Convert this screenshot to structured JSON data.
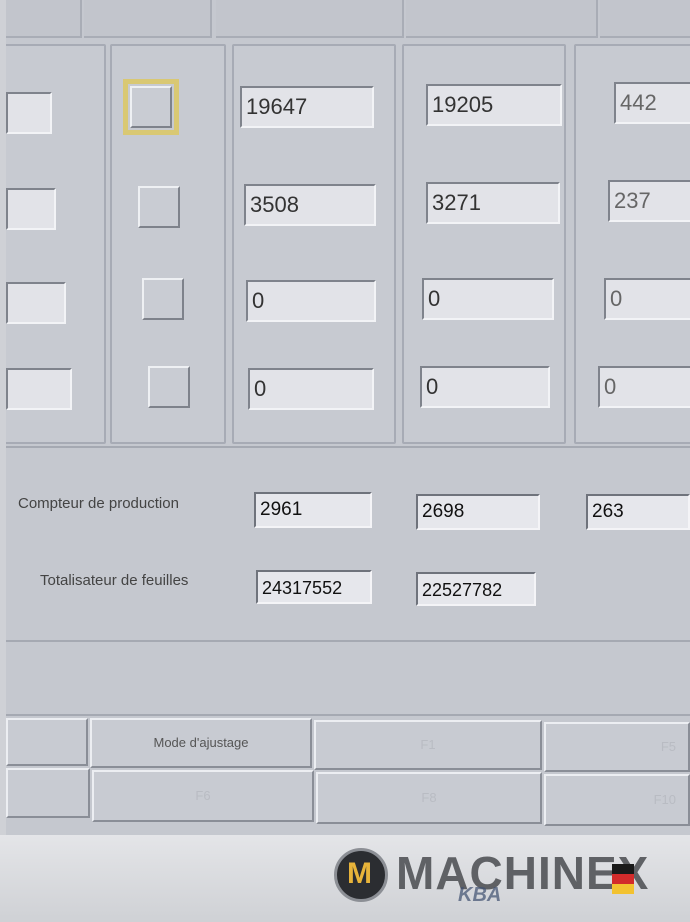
{
  "grid": {
    "rows": [
      {
        "selected": true,
        "col1": "19647",
        "col2": "19205",
        "col3": "442"
      },
      {
        "selected": false,
        "col1": "3508",
        "col2": "3271",
        "col3": "237"
      },
      {
        "selected": false,
        "col1": "0",
        "col2": "0",
        "col3": "0"
      },
      {
        "selected": false,
        "col1": "0",
        "col2": "0",
        "col3": "0"
      }
    ]
  },
  "counters": {
    "production_label": "Compteur de production",
    "production_values": [
      "2961",
      "2698",
      "263"
    ],
    "totalizer_label": "Totalisateur de feuilles",
    "totalizer_values": [
      "24317552",
      "22527782"
    ]
  },
  "buttons": {
    "row1": [
      "",
      "Mode d'ajustage",
      "F1",
      "F5"
    ],
    "row2": [
      "",
      "F6",
      "F8",
      "F10"
    ]
  },
  "watermark": {
    "brand": "MACHINEX",
    "sub": "KBA",
    "colors": {
      "accent": "#e8b43a",
      "flag_black": "#1a1a1a",
      "flag_red": "#d22b2b",
      "flag_gold": "#f2c230"
    }
  }
}
